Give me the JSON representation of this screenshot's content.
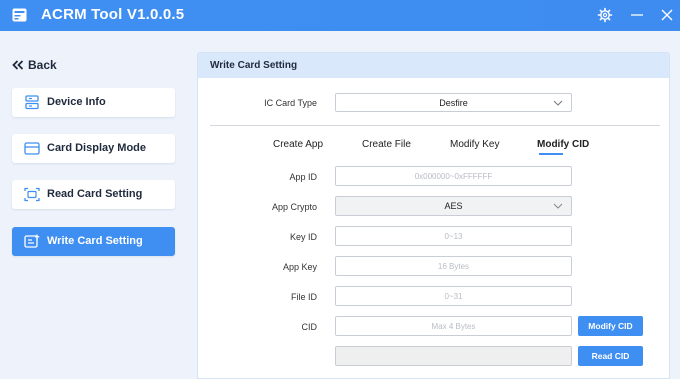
{
  "window": {
    "title": "ACRM Tool V1.0.0.5",
    "icons": {
      "app": "card-reader-icon",
      "settings": "gear-icon",
      "minimize": "minimize-icon",
      "close": "close-icon"
    },
    "accent_color": "#3f8ff2"
  },
  "sidebar": {
    "back_label": "Back",
    "items": [
      {
        "label": "Device Info",
        "icon": "device-info-icon",
        "active": false
      },
      {
        "label": "Card Display Mode",
        "icon": "card-icon",
        "active": false
      },
      {
        "label": "Read Card Setting",
        "icon": "read-card-icon",
        "active": false
      },
      {
        "label": "Write Card Setting",
        "icon": "write-card-icon",
        "active": true
      }
    ]
  },
  "panel": {
    "title": "Write Card Setting",
    "ic_card_type": {
      "label": "IC Card Type",
      "value": "Desfire"
    },
    "tabs": [
      {
        "label": "Create App",
        "active": false
      },
      {
        "label": "Create File",
        "active": false
      },
      {
        "label": "Modify Key",
        "active": false
      },
      {
        "label": "Modify CID",
        "active": true
      }
    ],
    "fields": {
      "app_id": {
        "label": "App ID",
        "placeholder": "0x000000~0xFFFFFF",
        "value": ""
      },
      "app_crypto": {
        "label": "App Crypto",
        "value": "AES"
      },
      "key_id": {
        "label": "Key ID",
        "placeholder": "0~13",
        "value": ""
      },
      "app_key": {
        "label": "App Key",
        "placeholder": "16 Bytes",
        "value": ""
      },
      "file_id": {
        "label": "File ID",
        "placeholder": "0~31",
        "value": ""
      },
      "cid": {
        "label": "CID",
        "placeholder": "Max 4 Bytes",
        "value": ""
      },
      "read_result": {
        "value": ""
      }
    },
    "buttons": {
      "modify_cid": "Modify CID",
      "read_cid": "Read CID"
    }
  }
}
